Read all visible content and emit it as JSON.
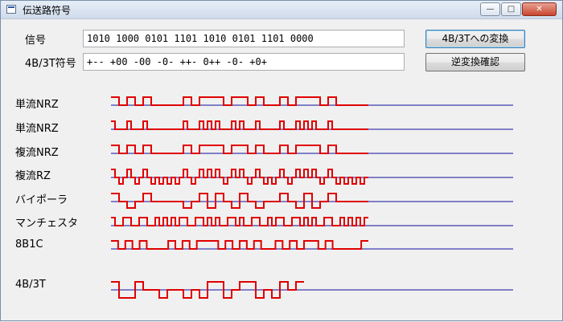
{
  "window": {
    "title": "伝送路符号",
    "minimize_symbol": "—",
    "maximize_symbol": "□",
    "close_symbol": "✕"
  },
  "form": {
    "signal_label": "信号",
    "signal_value": "1010 1000 0101 1101 1010 0101 1101 0000",
    "code_label": "4B/3T符号",
    "code_value": "+-- +00 -00 -0- ++- 0++ -0- +0+",
    "convert_button": "4B/3Tへの変換",
    "reverse_button": "逆変換確認"
  },
  "bits": "10101000010111011010010111010000",
  "symbols_4b3t": "+--+00-00-0-++-0++-0-+0+",
  "rows": [
    {
      "label": "単流NRZ",
      "encoding": "unipolar-nrz"
    },
    {
      "label": "単流NRZ",
      "encoding": "unipolar-rz"
    },
    {
      "label": "複流NRZ",
      "encoding": "bipolar-nrz"
    },
    {
      "label": "複流RZ",
      "encoding": "bipolar-rz"
    },
    {
      "label": "バイポーラ",
      "encoding": "ami"
    },
    {
      "label": "マンチェスタ",
      "encoding": "manchester"
    },
    {
      "label": "8B1C",
      "encoding": "8b1c"
    },
    {
      "label": "4B/3T",
      "encoding": "4b3t"
    }
  ],
  "colors": {
    "signal": "#e00000",
    "baseline": "#1010a0"
  }
}
